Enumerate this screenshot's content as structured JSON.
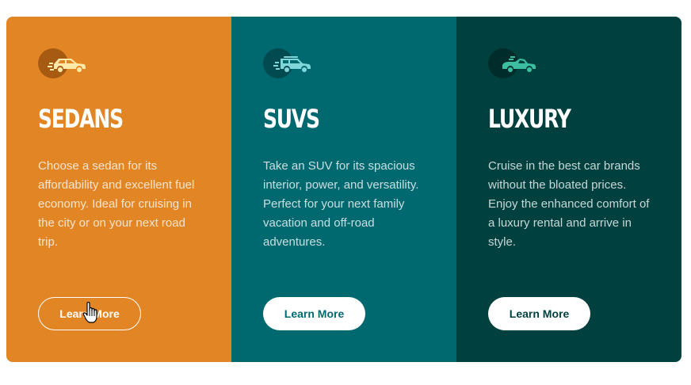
{
  "cards": [
    {
      "id": "sedans",
      "icon": "sedan-car-icon",
      "title": "SEDANS",
      "description": "Choose a sedan for its affordability and excellent fuel economy. Ideal for cruising in the city or on your next road trip.",
      "button_label": "Learn More",
      "background_color": "#e28625",
      "icon_color": "#ffe9a8"
    },
    {
      "id": "suvs",
      "icon": "suv-car-icon",
      "title": "SUVS",
      "description": "Take an SUV for its spacious interior, power, and versatility. Perfect for your next family vacation and off-road adventures.",
      "button_label": "Learn More",
      "background_color": "#006970",
      "icon_color": "#7fd6db"
    },
    {
      "id": "luxury",
      "icon": "luxury-car-icon",
      "title": "LUXURY",
      "description": "Cruise in the best car brands without the bloated prices. Enjoy the enhanced comfort of a luxury rental and arrive in style.",
      "button_label": "Learn More",
      "background_color": "#004140",
      "icon_color": "#3bbfa0"
    }
  ],
  "cursor": {
    "icon": "hand-pointer-cursor-icon"
  }
}
